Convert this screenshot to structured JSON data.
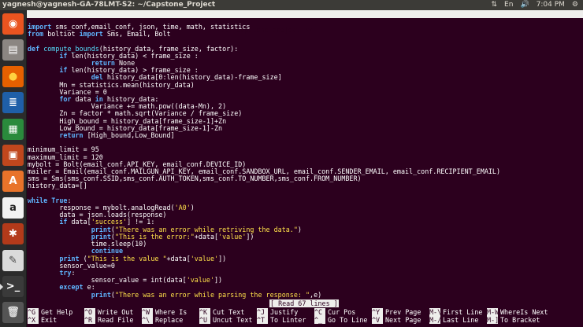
{
  "topbar": {
    "window_title": "yagnesh@yagnesh-GA-78LMT-S2: ~/Capstone_Project",
    "time": "7:04 PM",
    "lang": "En",
    "volume_glyph": "🔊",
    "wifi_glyph": "⇅",
    "power_glyph": "⚙"
  },
  "launcher": {
    "items": [
      {
        "name": "dash-icon",
        "glyph": "◉"
      },
      {
        "name": "files-icon",
        "glyph": "▤"
      },
      {
        "name": "firefox-icon",
        "glyph": "●"
      },
      {
        "name": "writer-icon",
        "glyph": "≣"
      },
      {
        "name": "calc-icon",
        "glyph": "▦"
      },
      {
        "name": "impress-icon",
        "glyph": "▣"
      },
      {
        "name": "software-center-icon",
        "glyph": "A"
      },
      {
        "name": "amazon-icon",
        "glyph": "a"
      },
      {
        "name": "settings-icon",
        "glyph": "✱"
      },
      {
        "name": "text-editor-icon",
        "glyph": "✎"
      },
      {
        "name": "terminal-icon",
        "glyph": ">_"
      },
      {
        "name": "trash-icon",
        "glyph": "🗑"
      }
    ]
  },
  "nano": {
    "version": "GNU nano 2.5.3",
    "file_label": "File: capstone_project.py",
    "status": "[ Read 67 lines ]"
  },
  "code_lines": [
    "import sms_conf,email_conf, json, time, math, statistics",
    "from boltiot import Sms, Email, Bolt",
    "",
    "def compute_bounds(history_data, frame_size, factor):",
    "        if len(history_data) < frame_size :",
    "                return None",
    "        if len(history_data) > frame_size :",
    "                del history_data[0:len(history_data)-frame_size]",
    "        Mn = statistics.mean(history_data)",
    "        Variance = 0",
    "        for data in history_data:",
    "                Variance += math.pow((data-Mn), 2)",
    "        Zn = factor * math.sqrt(Variance / frame_size)",
    "        High_bound = history_data[frame_size-1]+Zn",
    "        Low_Bound = history_data[frame_size-1]-Zn",
    "        return [High_bound,Low_Bound]",
    "",
    "minimum_limit = 95",
    "maximum_limit = 120",
    "mybolt = Bolt(email_conf.API_KEY, email_conf.DEVICE_ID)",
    "mailer = Email(email_conf.MAILGUN_API_KEY, email_conf.SANDBOX_URL, email_conf.SENDER_EMAIL, email_conf.RECIPIENT_EMAIL)",
    "sms = Sms(sms_conf.SSID,sms_conf.AUTH_TOKEN,sms_conf.TO_NUMBER,sms_conf.FROM_NUMBER)",
    "history_data=[]",
    "",
    "while True:",
    "        response = mybolt.analogRead('A0')",
    "        data = json.loads(response)",
    "        if data['success'] != 1:",
    "                print(\"There was an error while retriving the data.\")",
    "                print(\"This is the error:\"+data['value'])",
    "                time.sleep(10)",
    "                continue",
    "        print (\"This is the value \"+data['value'])",
    "        sensor_value=0",
    "        try:",
    "                sensor_value = int(data['value'])",
    "        except e:",
    "                print(\"There was an error while parsing the response: \",e)"
  ],
  "shortcuts": [
    {
      "key": "^G",
      "label": "Get Help"
    },
    {
      "key": "^X",
      "label": "Exit"
    },
    {
      "key": "^O",
      "label": "Write Out"
    },
    {
      "key": "^R",
      "label": "Read File"
    },
    {
      "key": "^W",
      "label": "Where Is"
    },
    {
      "key": "^\\",
      "label": "Replace"
    },
    {
      "key": "^K",
      "label": "Cut Text"
    },
    {
      "key": "^U",
      "label": "Uncut Text"
    },
    {
      "key": "^J",
      "label": "Justify"
    },
    {
      "key": "^T",
      "label": "To Linter"
    },
    {
      "key": "^C",
      "label": "Cur Pos"
    },
    {
      "key": "^_",
      "label": "Go To Line"
    },
    {
      "key": "^Y",
      "label": "Prev Page"
    },
    {
      "key": "^V",
      "label": "Next Page"
    },
    {
      "key": "M-\\",
      "label": "First Line"
    },
    {
      "key": "M-/",
      "label": "Last Line"
    },
    {
      "key": "M-W",
      "label": "WhereIs Next"
    },
    {
      "key": "M-]",
      "label": "To Bracket"
    }
  ],
  "colors": {
    "terminal_bg": "#2c001e",
    "launcher_bg": "#2b2b2b",
    "topbar_bg": "#3c3b37",
    "keyword": "#5fb5ff",
    "string": "#ffe14a",
    "function_name": "#55e0ff"
  }
}
